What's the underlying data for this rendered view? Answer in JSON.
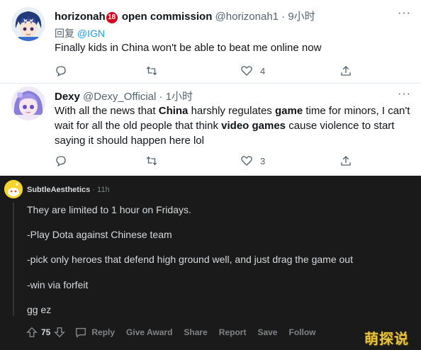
{
  "tweet1": {
    "name": "horizonah",
    "badge": "18",
    "name_suffix": " open commission",
    "handle": "@horizonah1",
    "time": " · 9小时",
    "reply_prefix": "回复 ",
    "reply_mention": "@IGN",
    "text": "Finally kids in China won't be able to beat me online now",
    "likes": "4"
  },
  "tweet2": {
    "name": "Dexy",
    "handle": "@Dexy_Official",
    "time": " · 1小时",
    "text_parts": [
      "With all the news that ",
      "China",
      " harshly regulates ",
      "game",
      " time for minors, I can't wait for all the old people that think ",
      "video games",
      " cause violence to start saying it should happen here lol"
    ],
    "likes": "3"
  },
  "reddit": {
    "username": "SubtleAesthetics",
    "time": " · 11h",
    "lines": [
      "They are limited to 1 hour on Fridays.",
      "-Play Dota against Chinese team",
      "-pick only heroes that defend high ground well, and just drag the game out",
      "-win via forfeit",
      "gg ez"
    ],
    "score": "75",
    "actions": [
      "Reply",
      "Give Award",
      "Share",
      "Report",
      "Save",
      "Follow"
    ]
  },
  "watermark": "萌探说",
  "icons": {
    "reply": "reply-icon",
    "retweet": "retweet-icon",
    "like": "heart-icon",
    "share": "share-icon",
    "upvote": "upvote-icon",
    "downvote": "downvote-icon",
    "comment": "comment-icon"
  },
  "colors": {
    "link": "#1d9bf0",
    "badge": "#d0021b",
    "reddit_bg": "#1a1a1b",
    "reddit_text": "#d7dadc",
    "reddit_muted": "#818384"
  }
}
